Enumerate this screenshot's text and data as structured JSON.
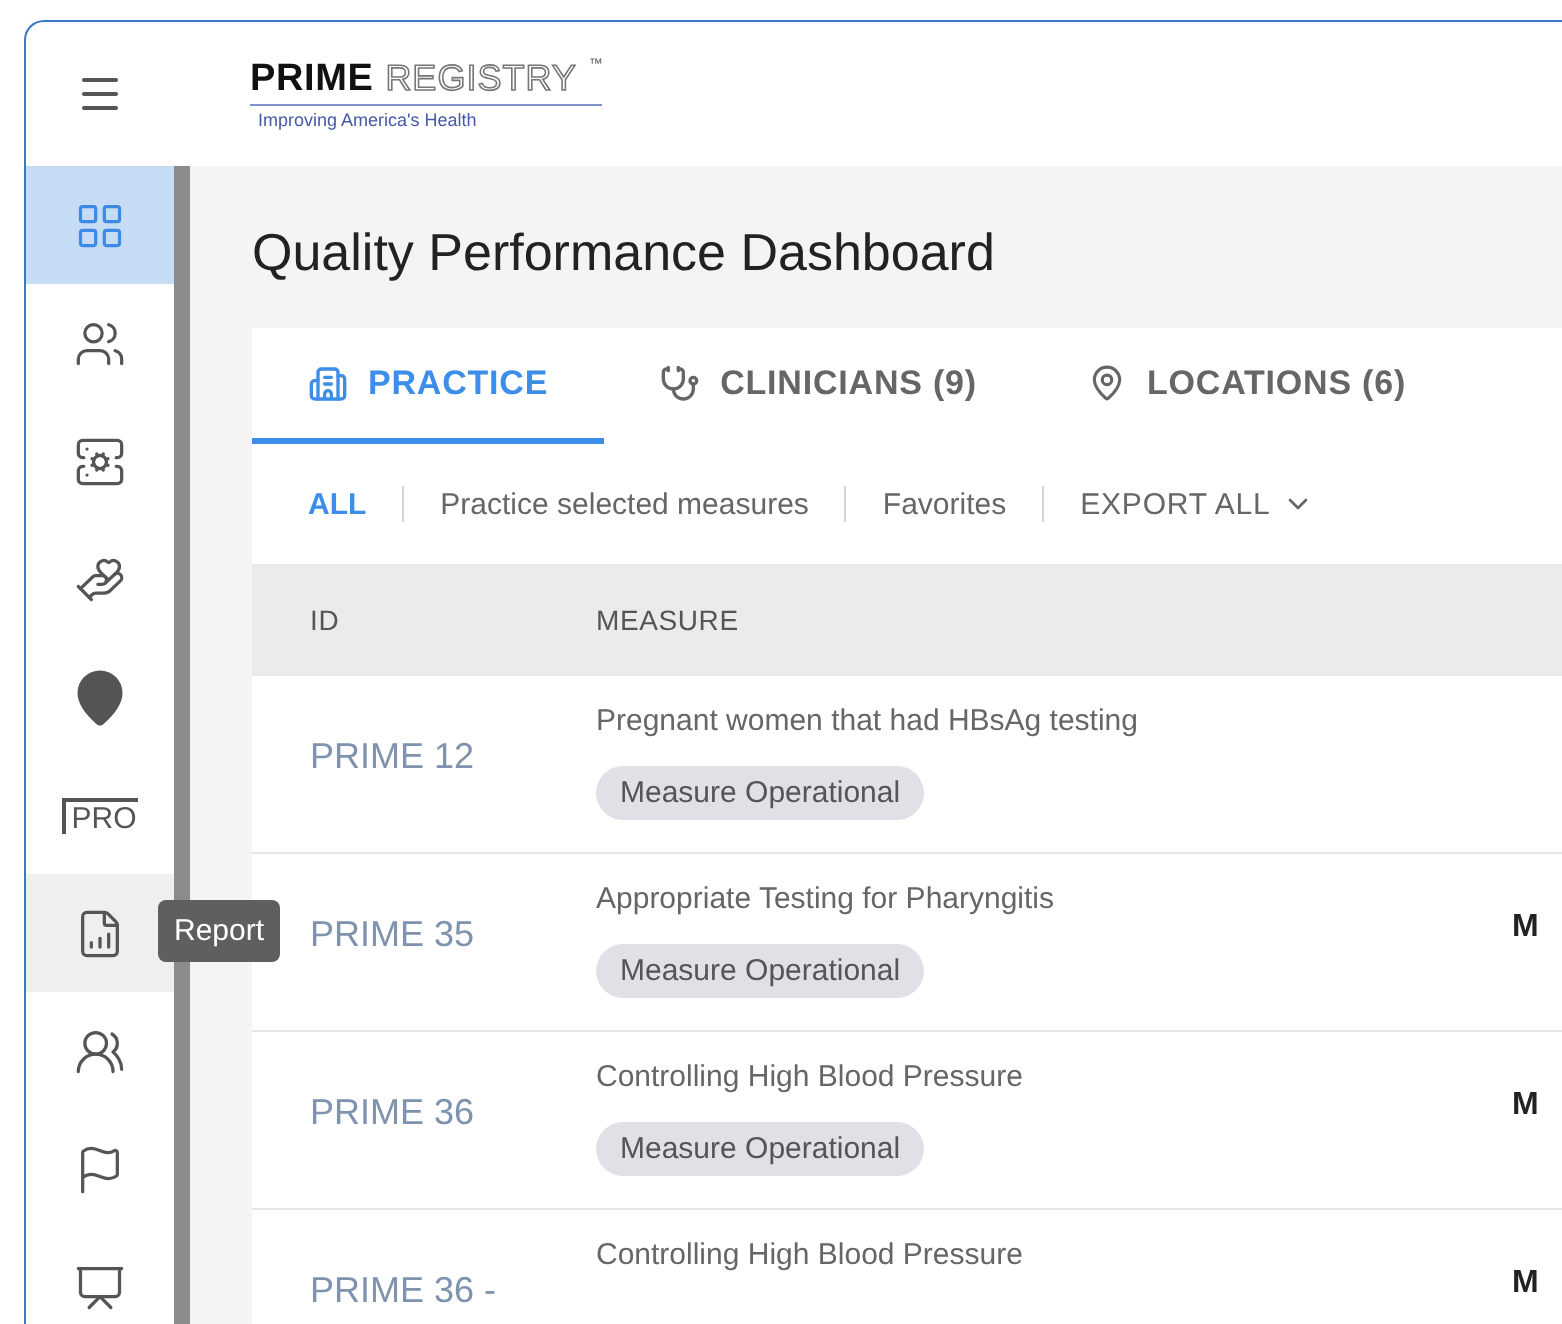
{
  "header": {
    "logo": {
      "primary": "PRIME",
      "secondary": "REGISTRY",
      "mark": "™",
      "tagline": "Improving America's Health"
    }
  },
  "sidebar": {
    "items": [
      {
        "kind": "icon",
        "selected": true,
        "hovered": false
      },
      {
        "kind": "icon",
        "selected": false,
        "hovered": false
      },
      {
        "kind": "icon",
        "selected": false,
        "hovered": false
      },
      {
        "kind": "icon",
        "selected": false,
        "hovered": false
      },
      {
        "kind": "icon",
        "selected": false,
        "hovered": false
      },
      {
        "kind": "text",
        "label": "PRO",
        "selected": false,
        "hovered": false
      },
      {
        "kind": "icon",
        "selected": false,
        "hovered": true,
        "tooltip": "Report"
      },
      {
        "kind": "icon",
        "selected": false,
        "hovered": false
      },
      {
        "kind": "icon",
        "selected": false,
        "hovered": false
      },
      {
        "kind": "icon",
        "selected": false,
        "hovered": false
      }
    ]
  },
  "page": {
    "title": "Quality Performance Dashboard"
  },
  "tabs": [
    {
      "label": "PRACTICE",
      "selected": true
    },
    {
      "label": "CLINICIANS (9)",
      "selected": false
    },
    {
      "label": "LOCATIONS (6)",
      "selected": false
    }
  ],
  "filters": [
    {
      "label": "ALL",
      "selected": true
    },
    {
      "label": "Practice selected measures",
      "selected": false
    },
    {
      "label": "Favorites",
      "selected": false
    }
  ],
  "export": {
    "label": "EXPORT ALL"
  },
  "table": {
    "columns": [
      "ID",
      "MEASURE"
    ],
    "rows": [
      {
        "id": "PRIME 12",
        "measure": "Pregnant women that had HBsAg testing",
        "badge": "Measure Operational"
      },
      {
        "id": "PRIME 35",
        "measure": "Appropriate Testing for Pharyngitis",
        "badge": "Measure Operational",
        "column_3": "M"
      },
      {
        "id": "PRIME 36",
        "measure": "Controlling High Blood Pressure",
        "badge": "Measure Operational",
        "column_3": "M"
      },
      {
        "id": "PRIME 36 -",
        "measure": "Controlling High Blood Pressure",
        "column_3": "M"
      }
    ]
  }
}
